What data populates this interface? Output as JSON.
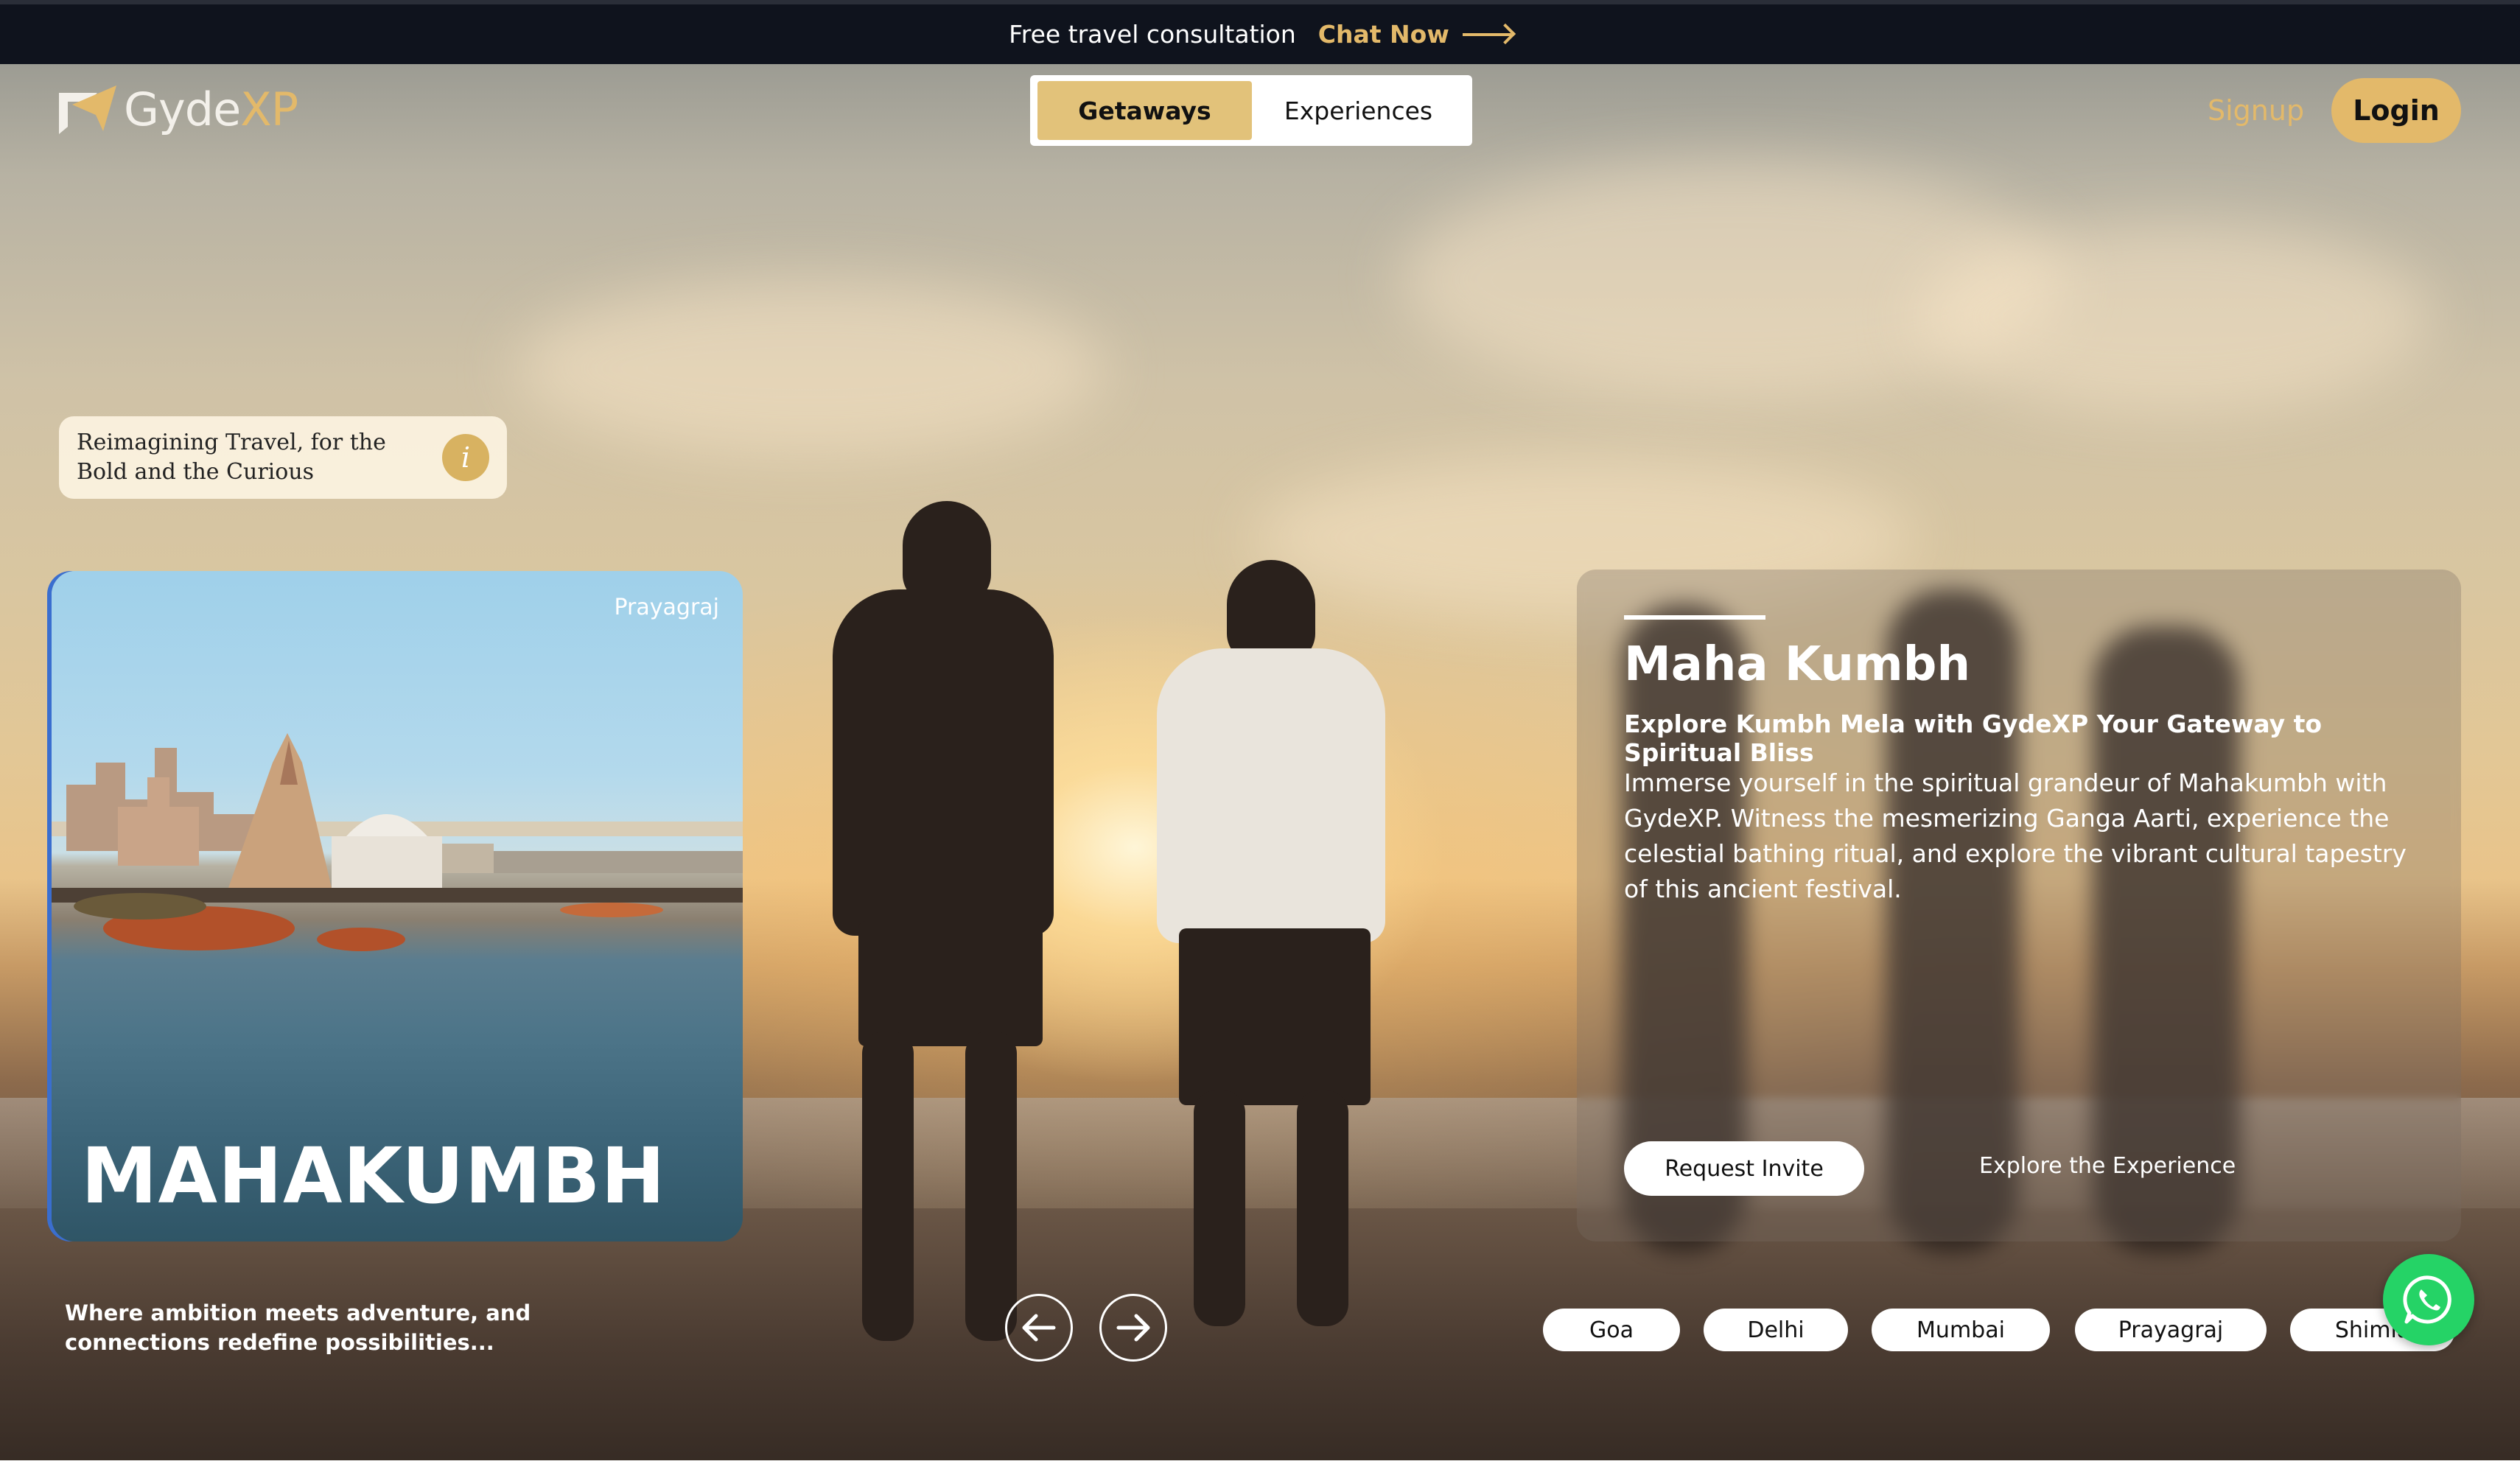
{
  "banner": {
    "text": "Free travel consultation",
    "cta": "Chat Now",
    "cta_icon": "arrow-right-icon"
  },
  "header": {
    "logo_part1": "Gyde",
    "logo_part2": "XP",
    "tabs": [
      {
        "label": "Getaways",
        "active": true
      },
      {
        "label": "Experiences",
        "active": false
      }
    ],
    "signup": "Signup",
    "login": "Login"
  },
  "tagline": {
    "text": "Reimagining Travel, for the Bold and the Curious",
    "icon": "info-icon",
    "icon_glyph": "i"
  },
  "destination_card": {
    "location": "Prayagraj",
    "title": "MAHAKUMBH"
  },
  "sub_tagline": "Where ambition meets adventure, and connections redefine possibilities...",
  "carousel": {
    "prev_icon": "arrow-left-icon",
    "next_icon": "arrow-right-icon"
  },
  "info_panel": {
    "title": "Maha Kumbh",
    "subtitle": "Explore Kumbh Mela with GydeXP Your Gateway to Spiritual Bliss",
    "description": "Immerse yourself in the spiritual grandeur of Mahakumbh with GydeXP. Witness the mesmerizing Ganga Aarti, experience the celestial bathing ritual, and explore the vibrant cultural tapestry of this ancient festival.",
    "request_button": "Request Invite",
    "explore_link": "Explore the Experience"
  },
  "cities": [
    "Goa",
    "Delhi",
    "Mumbai",
    "Prayagraj",
    "Shimla"
  ],
  "colors": {
    "accent": "#e3b96a",
    "toggle_active": "#e2c27a",
    "banner_bg": "#0f131d",
    "whatsapp": "#25d366"
  }
}
